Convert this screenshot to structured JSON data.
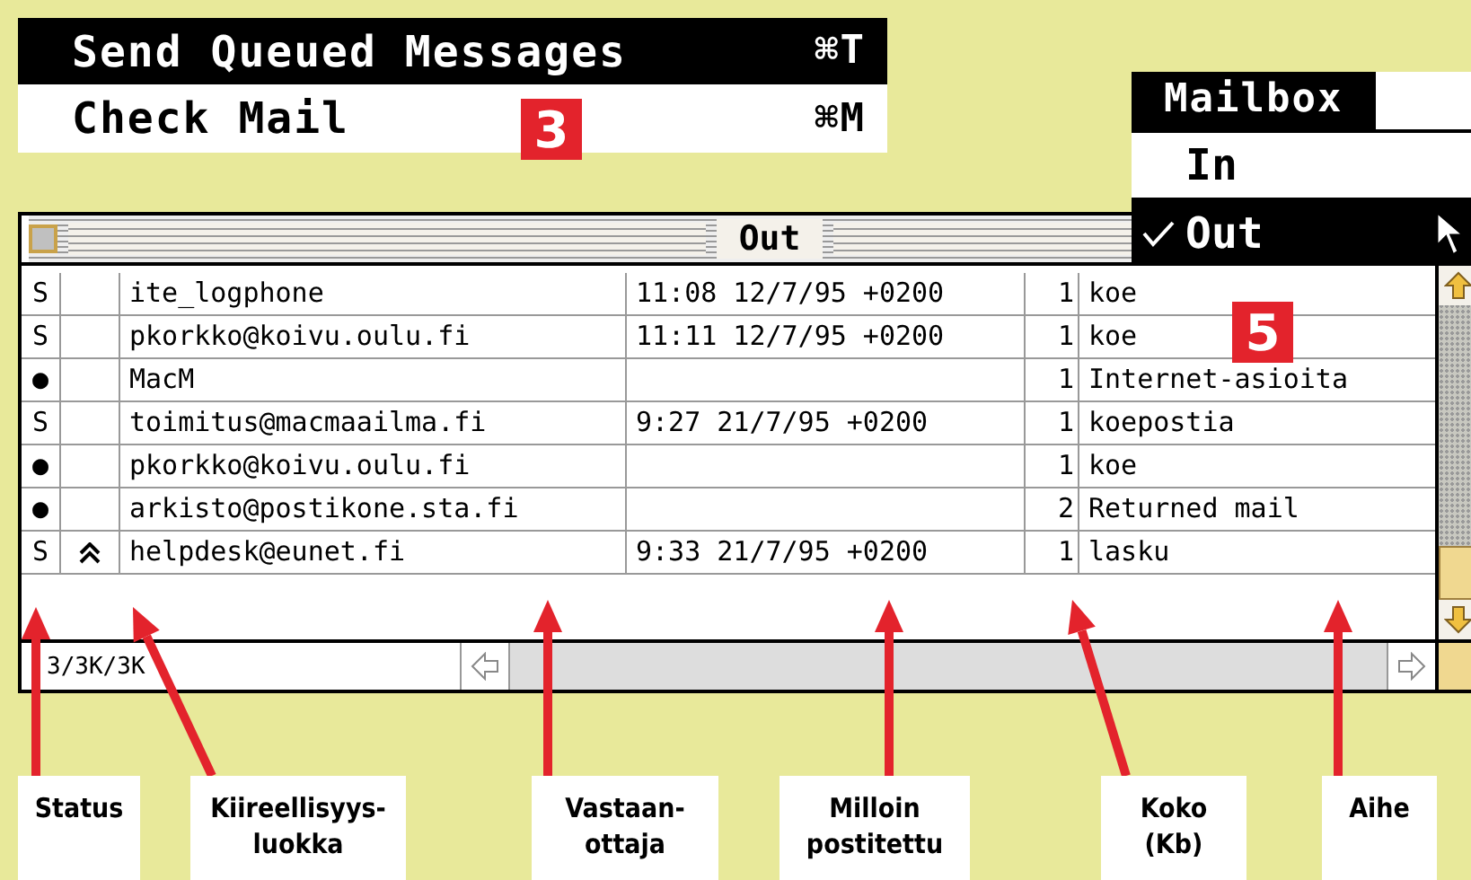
{
  "menu": {
    "items": [
      {
        "label": "Send Queued Messages",
        "shortcut": "⌘T",
        "selected": true
      },
      {
        "label": "Check Mail",
        "shortcut": "⌘M",
        "selected": false
      }
    ]
  },
  "badges": [
    {
      "text": "3"
    },
    {
      "text": "5"
    }
  ],
  "mailbox_menu": {
    "title": "Mailbox",
    "items": [
      {
        "label": "In",
        "checked": false,
        "selected": false
      },
      {
        "label": "Out",
        "checked": true,
        "selected": true
      }
    ]
  },
  "window": {
    "title": "Out",
    "status_text": "3/3K/3K",
    "rows": [
      {
        "status": "S",
        "priority_high": false,
        "to": "ite_logphone",
        "date": "11:08 12/7/95 +0200",
        "size": "1",
        "subject": "koe"
      },
      {
        "status": "S",
        "priority_high": false,
        "to": "pkorkko@koivu.oulu.fi",
        "date": "11:11 12/7/95 +0200",
        "size": "1",
        "subject": "koe"
      },
      {
        "status": "●",
        "priority_high": false,
        "to": "MacM",
        "size": "1",
        "subject": "Internet-asioita"
      },
      {
        "status": "S",
        "priority_high": false,
        "to": "toimitus@macmaailma.fi",
        "date": "9:27 21/7/95 +0200",
        "size": "1",
        "subject": "koepostia"
      },
      {
        "status": "●",
        "priority_high": false,
        "to": "pkorkko@koivu.oulu.fi",
        "size": "1",
        "subject": "koe"
      },
      {
        "status": "●",
        "priority_high": false,
        "to": "arkisto@postikone.sta.fi",
        "size": "2",
        "subject": "Returned mail"
      },
      {
        "status": "S",
        "priority_high": true,
        "to": "helpdesk@eunet.fi",
        "date": "9:33 21/7/95 +0200",
        "size": "1",
        "subject": "lasku"
      }
    ]
  },
  "callouts": [
    {
      "lines": [
        "Status"
      ]
    },
    {
      "lines": [
        "Kiireellisyys-",
        "luokka"
      ]
    },
    {
      "lines": [
        "Vastaan-",
        "ottaja"
      ]
    },
    {
      "lines": [
        "Milloin",
        "postitettu"
      ]
    },
    {
      "lines": [
        "Koko",
        "(Kb)"
      ]
    },
    {
      "lines": [
        "Aihe"
      ]
    }
  ]
}
